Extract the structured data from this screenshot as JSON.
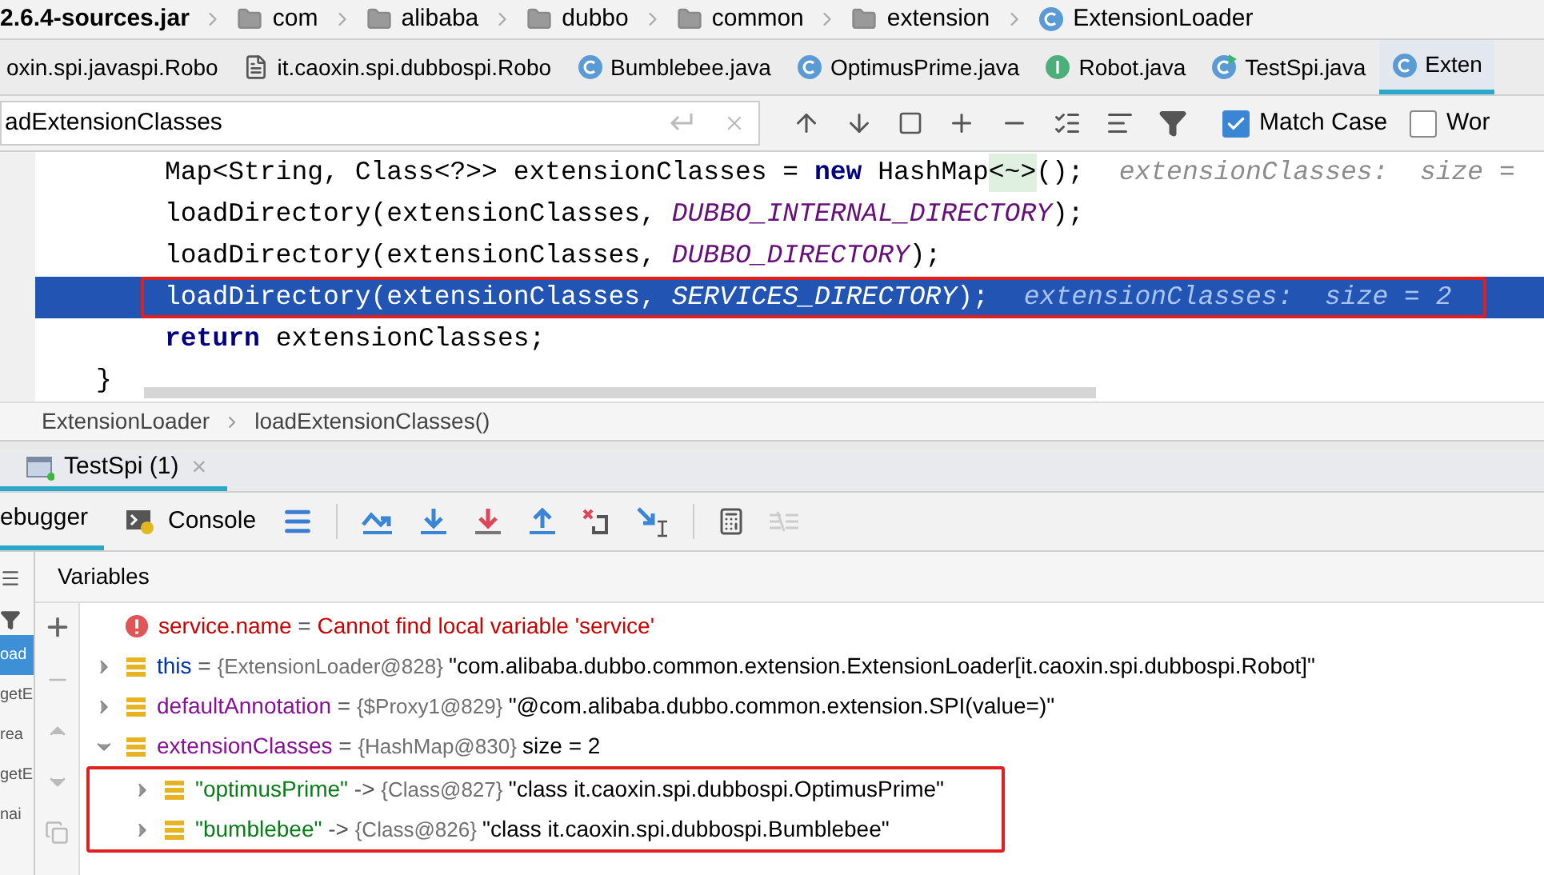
{
  "breadcrumb": [
    {
      "kind": "jar",
      "label": "2.6.4-sources.jar"
    },
    {
      "kind": "folder",
      "label": "com"
    },
    {
      "kind": "folder",
      "label": "alibaba"
    },
    {
      "kind": "folder",
      "label": "dubbo"
    },
    {
      "kind": "folder",
      "label": "common"
    },
    {
      "kind": "folder",
      "label": "extension"
    },
    {
      "kind": "class",
      "label": "ExtensionLoader"
    }
  ],
  "editor_tabs": [
    {
      "kind": "none",
      "label": "oxin.spi.javaspi.Robo",
      "selected": false
    },
    {
      "kind": "file",
      "label": "it.caoxin.spi.dubbospi.Robo",
      "selected": false
    },
    {
      "kind": "class",
      "label": "Bumblebee.java",
      "selected": false
    },
    {
      "kind": "class",
      "label": "OptimusPrime.java",
      "selected": false
    },
    {
      "kind": "interface",
      "label": "Robot.java",
      "selected": false
    },
    {
      "kind": "runnable",
      "label": "TestSpi.java",
      "selected": false
    },
    {
      "kind": "locked",
      "label": "Exten",
      "selected": true
    }
  ],
  "search": {
    "value": "adExtensionClasses",
    "options": [
      {
        "label": "Match Case",
        "checked": true
      },
      {
        "label": "Wor",
        "checked": false
      }
    ]
  },
  "code": [
    {
      "current": false,
      "boxed": false,
      "tokens": [
        {
          "kind": "plain",
          "text": "Map<String, Class<?>> extensionClasses = "
        },
        {
          "kind": "keyword",
          "text": "new"
        },
        {
          "kind": "plain",
          "text": " HashMap"
        },
        {
          "kind": "fold",
          "text": "<~>"
        },
        {
          "kind": "plain",
          "text": "();"
        },
        {
          "kind": "hint",
          "text": "extensionClasses:  size = "
        }
      ]
    },
    {
      "current": false,
      "boxed": false,
      "tokens": [
        {
          "kind": "plain",
          "text": "loadDirectory(extensionClasses, "
        },
        {
          "kind": "constant",
          "text": "DUBBO_INTERNAL_DIRECTORY"
        },
        {
          "kind": "plain",
          "text": ");"
        }
      ]
    },
    {
      "current": false,
      "boxed": false,
      "tokens": [
        {
          "kind": "plain",
          "text": "loadDirectory(extensionClasses, "
        },
        {
          "kind": "constant",
          "text": "DUBBO_DIRECTORY"
        },
        {
          "kind": "plain",
          "text": ");"
        }
      ]
    },
    {
      "current": true,
      "boxed": true,
      "tokens": [
        {
          "kind": "plain",
          "text": "loadDirectory(extensionClasses, "
        },
        {
          "kind": "constant",
          "text": "SERVICES_DIRECTORY"
        },
        {
          "kind": "plain",
          "text": ");"
        },
        {
          "kind": "hint",
          "text": "extensionClasses:  size = 2"
        }
      ]
    },
    {
      "current": false,
      "boxed": false,
      "tokens": [
        {
          "kind": "keyword",
          "text": "return"
        },
        {
          "kind": "plain",
          "text": " extensionClasses;"
        }
      ]
    },
    {
      "current": false,
      "boxed": false,
      "outdent": true,
      "tokens": [
        {
          "kind": "plain",
          "text": "}"
        }
      ]
    }
  ],
  "code_breadcrumb": [
    "ExtensionLoader",
    "loadExtensionClasses()"
  ],
  "debug_tab": {
    "label": "TestSpi (1)",
    "close": "×"
  },
  "debug_toolbar": {
    "tabs": [
      {
        "label": "ebugger",
        "selected": true
      },
      {
        "label": "Console",
        "selected": false
      }
    ]
  },
  "frames": [
    {
      "label": "oad",
      "selected": true
    },
    {
      "label": "getE",
      "selected": false
    },
    {
      "label": "rea",
      "selected": false
    },
    {
      "label": "getE",
      "selected": false
    },
    {
      "label": "nai",
      "selected": false
    }
  ],
  "variables": {
    "title": "Variables",
    "rows": [
      {
        "kind": "error",
        "name": "service.name",
        "op": "=",
        "value": "Cannot find local variable 'service'"
      },
      {
        "kind": "self",
        "name": "this",
        "op": "=",
        "ref": "{ExtensionLoader@828}",
        "value": "\"com.alibaba.dubbo.common.extension.ExtensionLoader[it.caoxin.spi.dubbospi.Robot]\"",
        "expanded": false
      },
      {
        "kind": "field",
        "name": "defaultAnnotation",
        "op": "=",
        "ref": "{$Proxy1@829}",
        "value": "\"@com.alibaba.dubbo.common.extension.SPI(value=)\"",
        "expanded": false
      },
      {
        "kind": "field",
        "name": "extensionClasses",
        "op": "=",
        "ref": "{HashMap@830}",
        "value": "size = 2",
        "expanded": true,
        "children_boxed": true,
        "children": [
          {
            "kind": "entry",
            "name": "\"optimusPrime\"",
            "op": "->",
            "ref": "{Class@827}",
            "value": "\"class it.caoxin.spi.dubbospi.OptimusPrime\"",
            "expanded": false
          },
          {
            "kind": "entry",
            "name": "\"bumblebee\"",
            "op": "->",
            "ref": "{Class@826}",
            "value": "\"class it.caoxin.spi.dubbospi.Bumblebee\"",
            "expanded": false
          }
        ]
      }
    ]
  }
}
